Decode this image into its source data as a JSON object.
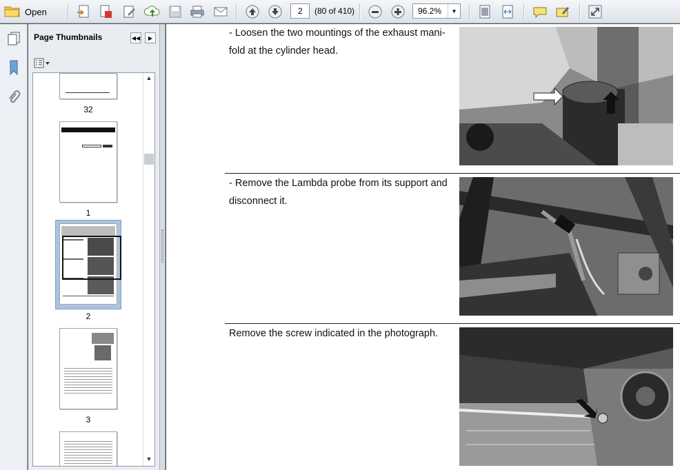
{
  "toolbar": {
    "open_label": "Open",
    "page_number": "2",
    "page_count": "(80 of 410)",
    "zoom": "96.2%"
  },
  "panel": {
    "title": "Page Thumbnails",
    "thumbnails": [
      {
        "label": "32"
      },
      {
        "label": "1"
      },
      {
        "label": "2"
      },
      {
        "label": "3"
      }
    ]
  },
  "document": {
    "steps": [
      {
        "text": "- Loosen the two mountings of the exhaust mani-fold at the cylinder head."
      },
      {
        "text": "- Remove the Lambda probe from its support and disconnect it."
      },
      {
        "text": "Remove the screw indicated in the photograph."
      }
    ]
  },
  "colors": {
    "selection": "#a9c4de",
    "toolbar_bg": "#e6ebf1"
  }
}
